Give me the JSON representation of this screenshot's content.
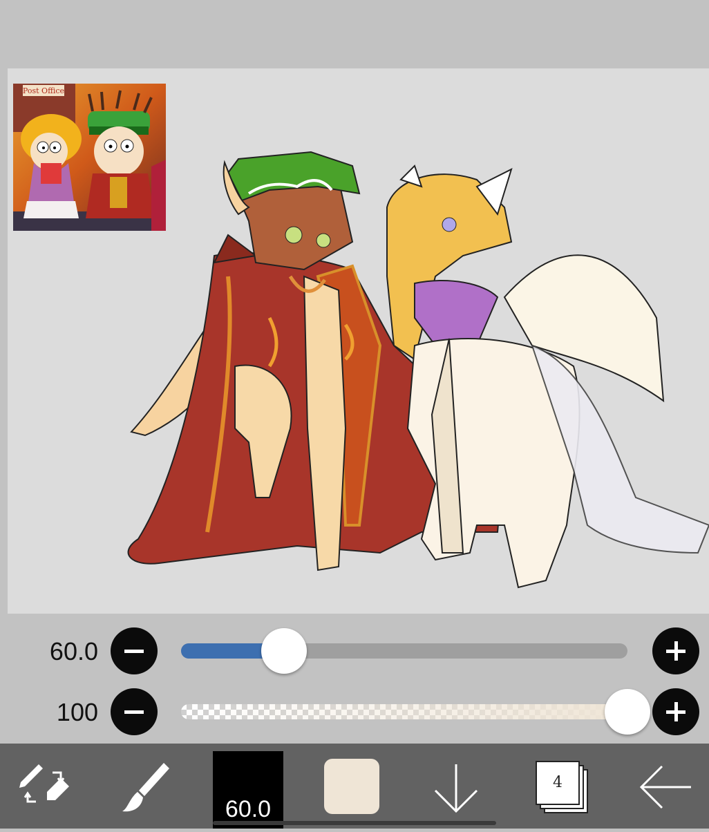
{
  "brush_size": {
    "value_label": "60.0",
    "fraction": 0.23,
    "minus_icon": "minus-icon",
    "plus_icon": "plus-icon",
    "track_color": "#9f9f9f",
    "fill_color": "#3d6fb0"
  },
  "opacity": {
    "value_label": "100",
    "fraction": 1.0,
    "minus_icon": "minus-icon",
    "plus_icon": "plus-icon",
    "color": "#efe5d6"
  },
  "toolbar": {
    "transform_tool_icon": "pen-eraser-swap-icon",
    "brush_tool_icon": "brush-icon",
    "brush_size_label": "60.0",
    "color_swatch": "#efe5d6",
    "download_icon": "arrow-down-icon",
    "layers_count": "4",
    "layers_icon": "layers-icon",
    "back_icon": "arrow-left-icon"
  },
  "canvas": {
    "background": "#dcdcdc",
    "reference_sign": "Post Office"
  }
}
